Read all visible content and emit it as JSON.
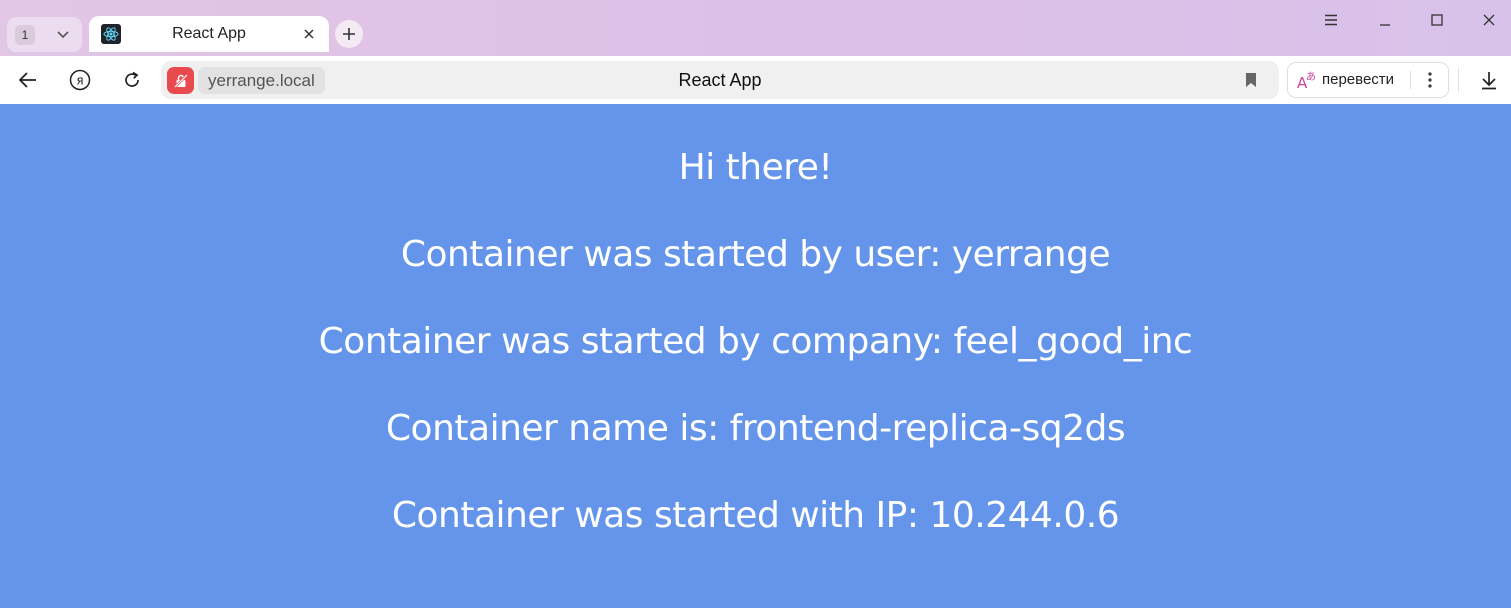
{
  "browser": {
    "tab_count": "1",
    "tab": {
      "title": "React App"
    },
    "address_bar": {
      "domain": "yerrange.local",
      "page_title": "React App"
    },
    "translate_button": {
      "label": "перевести"
    },
    "icons": {
      "tab_list": "chevron-down-icon",
      "favicon": "react-logo-icon",
      "close": "close-icon",
      "new_tab": "plus-icon",
      "menu": "hamburger-menu-icon",
      "minimize": "minimize-icon",
      "maximize": "maximize-icon",
      "window_close": "window-close-icon",
      "back": "back-arrow-icon",
      "yandex": "yandex-logo-icon",
      "reload": "reload-icon",
      "security": "insecure-connection-icon",
      "bookmark": "bookmark-icon",
      "translate": "translate-icon",
      "more": "more-vertical-icon",
      "download": "download-icon"
    },
    "colors": {
      "tabstrip": "#dcc1e7",
      "security_badge": "#e84a4e",
      "page_background": "#6495ea"
    }
  },
  "page": {
    "greeting": "Hi there!",
    "user_line": "Container was started by user: yerrange",
    "company_line": "Container was started by company: feel_good_inc",
    "name_line": "Container name is: frontend-replica-sq2ds",
    "ip_line": "Container was started with IP: 10.244.0.6"
  }
}
